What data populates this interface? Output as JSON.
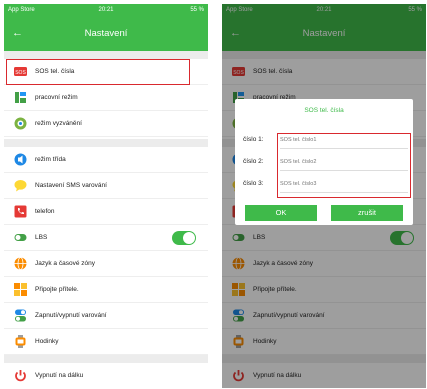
{
  "status_bar": {
    "left": "App Store",
    "time": "20:21",
    "right": "55 %"
  },
  "navbar": {
    "title": "Nastavení",
    "back_glyph": "←"
  },
  "menu_items": [
    {
      "label": "SOS tel. čísla",
      "icon": "sos-icon",
      "color": "#e53935"
    },
    {
      "label": "pracovní režim",
      "icon": "work-mode-icon",
      "color": "#43a047"
    },
    {
      "label": "režim vyzvánění",
      "icon": "ringtone-icon",
      "color": "#7cb342"
    },
    {
      "label": "režim třída",
      "icon": "class-mode-icon",
      "color": "#1e88e5"
    },
    {
      "label": "Nastavení SMS varování",
      "icon": "sms-icon",
      "color": "#fdd835"
    },
    {
      "label": "telefon",
      "icon": "phone-icon",
      "color": "#e53935"
    },
    {
      "label": "LBS",
      "icon": "lbs-icon",
      "color": "#43a047"
    },
    {
      "label": "Jazyk a časové zóny",
      "icon": "language-icon",
      "color": "#fb8c00"
    },
    {
      "label": "Připojte přítele.",
      "icon": "friend-icon",
      "color": "#fb8c00"
    },
    {
      "label": "Zapnutí/vypnutí varování",
      "icon": "alert-toggle-icon",
      "color": "#1e88e5"
    },
    {
      "label": "Hodinky",
      "icon": "watch-icon",
      "color": "#fb8c00"
    },
    {
      "label": "Vypnutí na dálku",
      "icon": "power-icon",
      "color": "#e53935"
    }
  ],
  "lbs_toggle": {
    "on": true
  },
  "dialog": {
    "title": "SOS tel. čísla",
    "fields": [
      {
        "label": "číslo 1:",
        "placeholder": "SOS tel. číslo1"
      },
      {
        "label": "číslo 2:",
        "placeholder": "SOS tel. číslo2"
      },
      {
        "label": "číslo 3:",
        "placeholder": "SOS tel. číslo3"
      }
    ],
    "ok_label": "OK",
    "cancel_label": "zrušit"
  },
  "colors": {
    "accent": "#3fba4a",
    "highlight": "#d9292e"
  }
}
